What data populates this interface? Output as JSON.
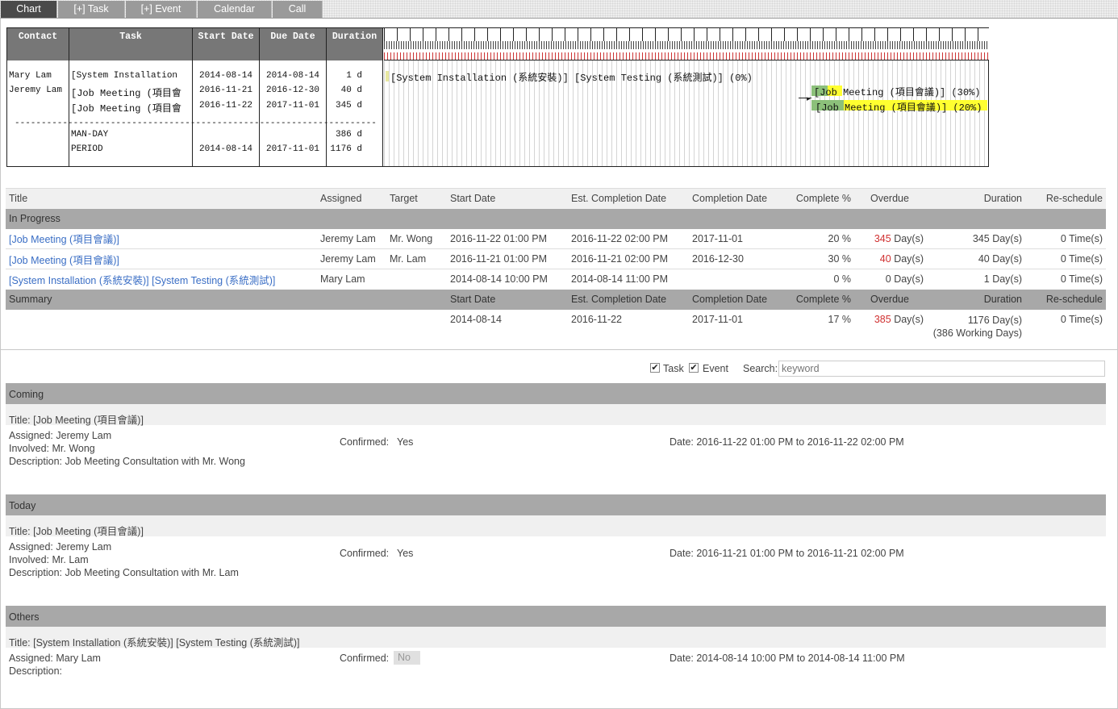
{
  "tabs": [
    {
      "label": "Chart",
      "active": true
    },
    {
      "label": "[+] Task",
      "active": false
    },
    {
      "label": "[+] Event",
      "active": false
    },
    {
      "label": "Calendar",
      "active": false
    },
    {
      "label": "Call",
      "active": false
    }
  ],
  "gantt": {
    "headers": {
      "contact": "Contact",
      "task": "Task",
      "start": "Start Date",
      "due": "Due Date",
      "duration": "Duration"
    },
    "rows": [
      {
        "contact": "Mary Lam",
        "task": "[System Installation",
        "start": "2014-08-14",
        "due": "2014-08-14",
        "duration": "1 d"
      },
      {
        "contact": "Jeremy Lam",
        "task": "[Job Meeting (項目會",
        "start": "2016-11-21",
        "due": "2016-12-30",
        "duration": "40 d"
      },
      {
        "contact": "",
        "task": "[Job Meeting (項目會",
        "start": "2016-11-22",
        "due": "2017-11-01",
        "duration": "345 d"
      }
    ],
    "separator": "------------------------------------------------------------------------------------",
    "totals": [
      {
        "label": "MAN-DAY",
        "start": "",
        "due": "",
        "duration": "386 d"
      },
      {
        "label": "PERIOD",
        "start": "2014-08-14",
        "due": "2017-11-01",
        "duration": "1176 d"
      }
    ],
    "bars": [
      "[System Installation (系統安裝)] [System Testing (系統測試)] (0%)",
      "[Job Meeting (項目會議)] (30%)",
      "[Job Meeting (項目會議)] (20%)"
    ]
  },
  "list": {
    "headers": [
      "Title",
      "Assigned",
      "Target",
      "Start Date",
      "Est. Completion Date",
      "Completion Date",
      "Complete %",
      "Overdue",
      "Duration",
      "Re-schedule"
    ],
    "in_progress_label": "In Progress",
    "rows": [
      {
        "title": "[Job Meeting (項目會議)]",
        "assigned": "Jeremy Lam",
        "target": "Mr. Wong",
        "start": "2016-11-22 01:00 PM",
        "est": "2016-11-22 02:00 PM",
        "completion": "2017-11-01",
        "pct": "20 %",
        "overdue_num": "345",
        "overdue_unit": "Day(s)",
        "duration": "345 Day(s)",
        "reschedule": "0 Time(s)"
      },
      {
        "title": "[Job Meeting (項目會議)]",
        "assigned": "Jeremy Lam",
        "target": "Mr. Lam",
        "start": "2016-11-21 01:00 PM",
        "est": "2016-11-21 02:00 PM",
        "completion": "2016-12-30",
        "pct": "30 %",
        "overdue_num": "40",
        "overdue_unit": "Day(s)",
        "duration": "40 Day(s)",
        "reschedule": "0 Time(s)"
      },
      {
        "title": "[System Installation (系統安裝)] [System Testing (系統測試)]",
        "assigned": "Mary Lam",
        "target": "",
        "start": "2014-08-14 10:00 PM",
        "est": "2014-08-14 11:00 PM",
        "completion": "",
        "pct": "0 %",
        "overdue_num": "",
        "overdue_unit": "0 Day(s)",
        "duration": "1 Day(s)",
        "reschedule": "0 Time(s)"
      }
    ],
    "summary_label": "Summary",
    "summary": {
      "start": "2014-08-14",
      "est": "2016-11-22",
      "completion": "2017-11-01",
      "pct": "17 %",
      "overdue_num": "385",
      "overdue_unit": "Day(s)",
      "duration": "1176 Day(s)",
      "working": "(386 Working Days)",
      "reschedule": "0 Time(s)"
    }
  },
  "filters": {
    "task_label": "Task",
    "event_label": "Event",
    "search_label": "Search:",
    "search_placeholder": "keyword"
  },
  "events": [
    {
      "section": "Coming",
      "title": "Title: [Job Meeting (項目會議)]",
      "assigned": "Assigned: Jeremy Lam",
      "involved": "Involved: Mr. Wong",
      "description": "Description: Job Meeting Consultation with Mr. Wong",
      "confirmed_label": "Confirmed:",
      "confirmed": "Yes",
      "date": "Date: 2016-11-22 01:00 PM to 2016-11-22 02:00 PM"
    },
    {
      "section": "Today",
      "title": "Title: [Job Meeting (項目會議)]",
      "assigned": "Assigned: Jeremy Lam",
      "involved": "Involved: Mr. Lam",
      "description": "Description: Job Meeting Consultation with Mr. Lam",
      "confirmed_label": "Confirmed:",
      "confirmed": "Yes",
      "date": "Date: 2016-11-21 01:00 PM to 2016-11-21 02:00 PM"
    },
    {
      "section": "Others",
      "title": "Title: [System Installation (系統安裝)] [System Testing (系統測試)]",
      "assigned": "Assigned: Mary Lam",
      "involved": "",
      "description": "Description:",
      "confirmed_label": "Confirmed:",
      "confirmed": "No",
      "date": "Date: 2014-08-14 10:00 PM to 2014-08-14 11:00 PM"
    }
  ]
}
